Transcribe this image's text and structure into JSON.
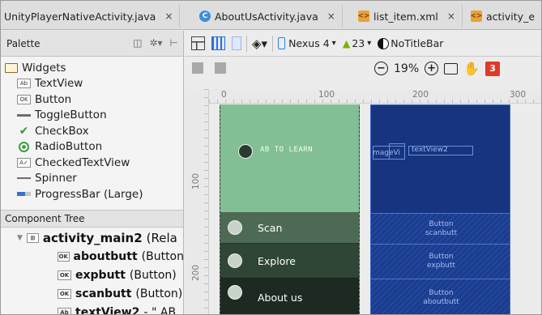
{
  "tabs": [
    {
      "label": "UnityPlayerNativeActivity.java",
      "icon": "java-file-icon"
    },
    {
      "label": "AboutUsActivity.java",
      "icon": "java-file-icon"
    },
    {
      "label": "list_item.xml",
      "icon": "xml-file-icon"
    },
    {
      "label": "activity_e",
      "icon": "xml-file-icon"
    }
  ],
  "tab_close_glyph": "×",
  "palette": {
    "title": "Palette",
    "group": "Widgets",
    "items": [
      {
        "label": "TextView",
        "icon": "Ab"
      },
      {
        "label": "Button",
        "icon": "OK"
      },
      {
        "label": "ToggleButton",
        "icon": "toggle"
      },
      {
        "label": "CheckBox",
        "icon": "check"
      },
      {
        "label": "RadioButton",
        "icon": "radio"
      },
      {
        "label": "CheckedTextView",
        "icon": "checked-text"
      },
      {
        "label": "Spinner",
        "icon": "spinner"
      },
      {
        "label": "ProgressBar (Large)",
        "icon": "progress"
      }
    ]
  },
  "component_tree": {
    "title": "Component Tree",
    "root": {
      "name": "activity_main2",
      "type": "(Rela"
    },
    "children": [
      {
        "name": "aboutbutt",
        "type": "(Button"
      },
      {
        "name": "expbutt",
        "type": "(Button)"
      },
      {
        "name": "scanbutt",
        "type": "(Button)"
      },
      {
        "name": "textView2",
        "type": "- \" AB"
      }
    ]
  },
  "toolbar": {
    "device": "Nexus 4",
    "api": "23",
    "theme": "NoTitleBar",
    "zoom": "19%",
    "error_count": "3"
  },
  "ruler": {
    "top": [
      "0",
      "100",
      "200",
      "300"
    ],
    "left": [
      "100",
      "200"
    ]
  },
  "preview": {
    "header_text": "AB TO LEARN",
    "buttons": [
      "Scan",
      "Explore",
      "About us"
    ],
    "colors": {
      "header": "#82bf94",
      "scan": "#4d6a55",
      "explore": "#2f4535",
      "about": "#1c2a21"
    }
  },
  "blueprint": {
    "image_label": "mageVi",
    "text_label": "textView2",
    "buttons": [
      {
        "title": "Button",
        "id": "scanbutt"
      },
      {
        "title": "Button",
        "id": "expbutt"
      },
      {
        "title": "Button",
        "id": "aboutbutt"
      }
    ],
    "colors": {
      "background": "#17357f"
    }
  }
}
